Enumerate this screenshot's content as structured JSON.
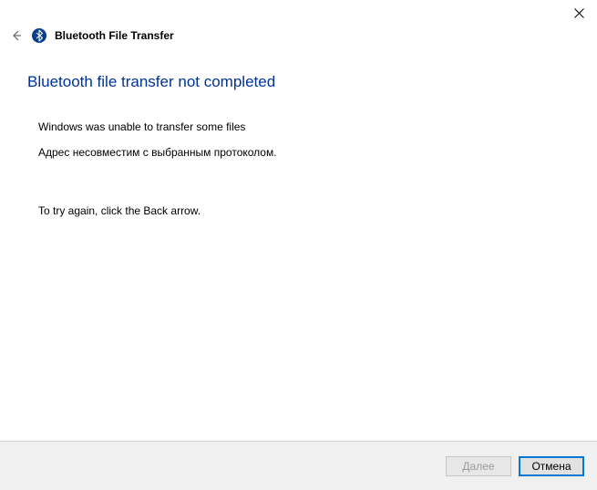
{
  "window": {
    "title": "Bluetooth File Transfer"
  },
  "page": {
    "heading": "Bluetooth file transfer not completed",
    "error_line1": "Windows was unable to transfer some files",
    "error_line2": "Адрес несовместим с выбранным протоколом.",
    "try_again": "To try again, click the Back arrow."
  },
  "footer": {
    "next_label": "Далее",
    "cancel_label": "Отмена"
  }
}
